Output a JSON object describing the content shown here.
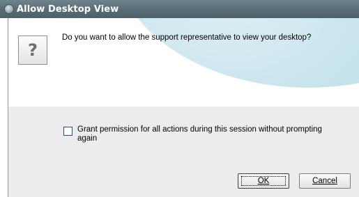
{
  "dialog": {
    "title": "Allow Desktop View",
    "question": "Do you want to allow the support representative to view your desktop?",
    "question_icon_glyph": "?",
    "checkbox_label": "Grant permission for all actions during this session without prompting again",
    "checkbox_checked": false,
    "ok_label": "OK",
    "cancel_label": "Cancel"
  },
  "colors": {
    "titlebar": "#5a6e77",
    "content_bg": "#ececec",
    "swoosh": "#c4e1ea"
  },
  "icons": {
    "title": "app-globe-icon",
    "question": "question-mark-icon"
  }
}
